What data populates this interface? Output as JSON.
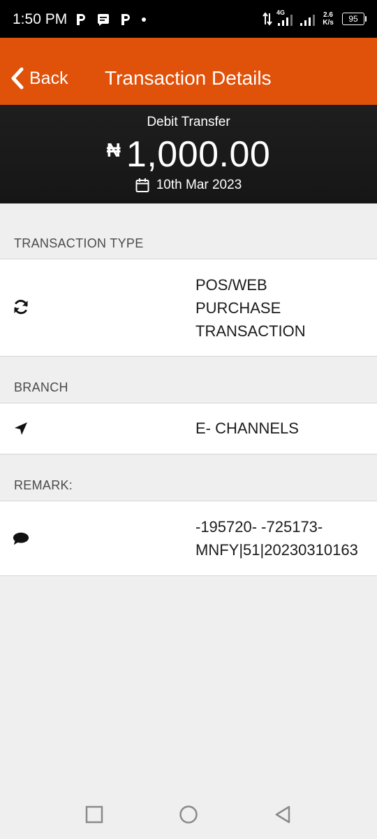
{
  "status_bar": {
    "time": "1:50 PM",
    "network": "4G",
    "speed_value": "2.6",
    "speed_unit": "K/s",
    "battery": "95"
  },
  "header": {
    "back_label": "Back",
    "title": "Transaction Details"
  },
  "summary": {
    "type": "Debit Transfer",
    "currency_symbol": "₦",
    "amount": "1,000.00",
    "date": "10th Mar 2023"
  },
  "sections": {
    "transaction_type": {
      "label": "TRANSACTION TYPE",
      "value": "POS/WEB\nPURCHASE\nTRANSACTION"
    },
    "branch": {
      "label": "BRANCH",
      "value": "E- CHANNELS"
    },
    "remark": {
      "label": "REMARK:",
      "line1": "-195720- -725173-",
      "line2": "MNFY|51|20230310163"
    }
  },
  "colors": {
    "app_bar": "#e0510a",
    "banner": "#1a1a1a",
    "background": "#efefef"
  }
}
